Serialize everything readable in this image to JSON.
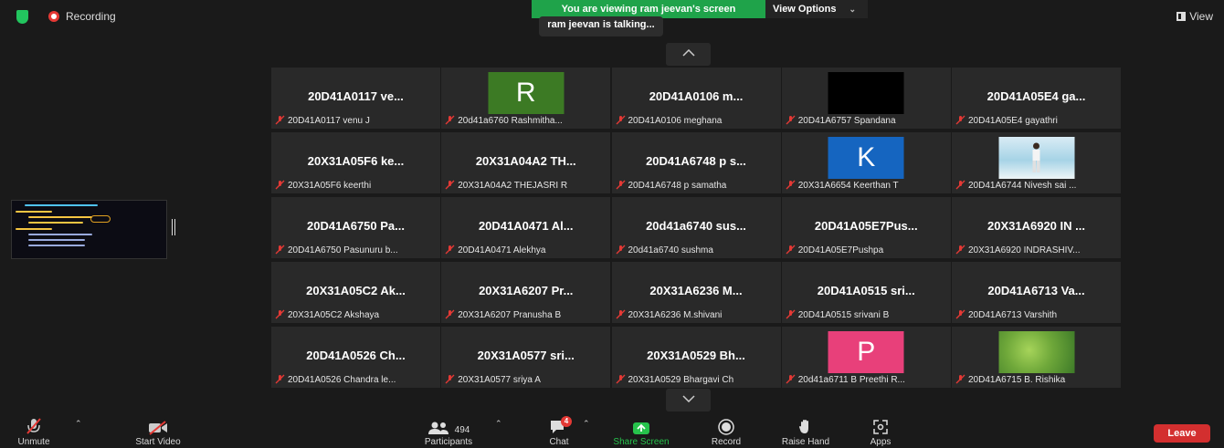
{
  "top": {
    "recording_label": "Recording",
    "view_label": "View",
    "viewing_banner": "You are viewing ram jeevan's screen",
    "view_options_label": "View Options",
    "talking": "ram jeevan is talking..."
  },
  "colors": {
    "banner_green": "#1fa34a",
    "leave_red": "#d32f2f",
    "tile_bg": "#292929",
    "mute_red": "#e53935"
  },
  "tiles": [
    {
      "title": "20D41A0117 ve...",
      "name": "20D41A0117 venu J"
    },
    {
      "avatar": "R",
      "avatar_color": "#3c7a24",
      "name": "20d41a6760 Rashmitha..."
    },
    {
      "title": "20D41A0106 m...",
      "name": "20D41A0106 meghana"
    },
    {
      "avatar": "",
      "avatar_color": "#000000",
      "name": "20D41A6757 Spandana"
    },
    {
      "title": "20D41A05E4 ga...",
      "name": "20D41A05E4 gayathri"
    },
    {
      "title": "20X31A05F6 ke...",
      "name": "20X31A05F6 keerthi"
    },
    {
      "title": "20X31A04A2 TH...",
      "name": "20X31A04A2 THEJASRI R"
    },
    {
      "title": "20D41A6748 p s...",
      "name": "20D41A6748 p samatha"
    },
    {
      "avatar": "K",
      "avatar_color": "#1565c0",
      "name": "20X31A6654 Keerthan T"
    },
    {
      "photo": "man-on-beach",
      "name": "20D41A6744 Nivesh sai ..."
    },
    {
      "title": "20D41A6750 Pa...",
      "name": "20D41A6750 Pasunuru b..."
    },
    {
      "title": "20D41A0471 Al...",
      "name": "20D41A0471 Alekhya"
    },
    {
      "title": "20d41a6740 sus...",
      "name": "20d41a6740 sushma"
    },
    {
      "title": "20D41A05E7Pus...",
      "name": "20D41A05E7Pushpa"
    },
    {
      "title": "20X31A6920 IN ...",
      "name": "20X31A6920 INDRASHIV..."
    },
    {
      "title": "20X31A05C2 Ak...",
      "name": "20X31A05C2 Akshaya"
    },
    {
      "title": "20X31A6207 Pr...",
      "name": "20X31A6207 Pranusha B"
    },
    {
      "title": "20X31A6236 M...",
      "name": "20X31A6236 M.shivani"
    },
    {
      "title": "20D41A0515 sri...",
      "name": "20D41A0515 srivani B"
    },
    {
      "title": "20D41A6713 Va...",
      "name": "20D41A6713 Varshith"
    },
    {
      "title": "20D41A0526 Ch...",
      "name": "20D41A0526 Chandra le..."
    },
    {
      "title": "20X31A0577 sri...",
      "name": "20X31A0577 sriya A"
    },
    {
      "title": "20X31A0529 Bh...",
      "name": "20X31A0529 Bhargavi Ch"
    },
    {
      "avatar": "P",
      "avatar_color": "#e8407a",
      "name": "20d41a6711 B Preethi R..."
    },
    {
      "photo": "green-leaves",
      "name": "20D41A6715 B. Rishika"
    }
  ],
  "toolbar": {
    "unmute": "Unmute",
    "start_video": "Start Video",
    "participants": "Participants",
    "participants_count": "494",
    "chat": "Chat",
    "chat_badge": "4",
    "share_screen": "Share Screen",
    "record": "Record",
    "raise_hand": "Raise Hand",
    "apps": "Apps",
    "leave": "Leave"
  }
}
